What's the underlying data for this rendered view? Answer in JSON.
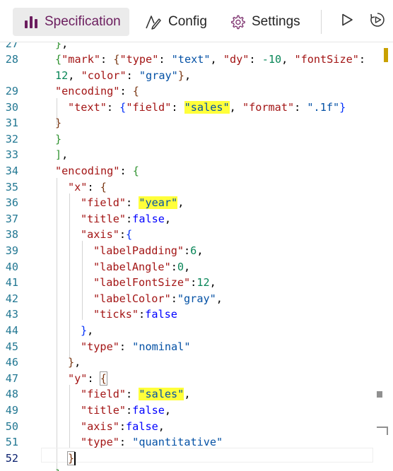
{
  "toolbar": {
    "tabs": [
      {
        "label": "Specification",
        "icon": "bar-chart-icon",
        "active": true
      },
      {
        "label": "Config",
        "icon": "pen-icon",
        "active": false
      },
      {
        "label": "Settings",
        "icon": "gear-icon",
        "active": false
      }
    ],
    "actions": [
      {
        "name": "run-button",
        "icon": "play-icon"
      },
      {
        "name": "auto-run-button",
        "icon": "auto-run-icon"
      }
    ],
    "accent_color": "#6b1d5e"
  },
  "editor": {
    "lines": [
      {
        "n": "27",
        "text": "},"
      },
      {
        "n": "28",
        "text": "{\"mark\": {\"type\": \"text\", \"dy\": -10, \"fontSize\":"
      },
      {
        "n": "",
        "text": "12, \"color\": \"gray\"},"
      },
      {
        "n": "29",
        "text": "\"encoding\": {"
      },
      {
        "n": "30",
        "text": "\"text\": {\"field\": \"sales\", \"format\": \".1f\"}"
      },
      {
        "n": "31",
        "text": "}"
      },
      {
        "n": "32",
        "text": "}"
      },
      {
        "n": "33",
        "text": "],"
      },
      {
        "n": "34",
        "text": "\"encoding\": {"
      },
      {
        "n": "35",
        "text": "\"x\": {"
      },
      {
        "n": "36",
        "text": "\"field\": \"year\","
      },
      {
        "n": "37",
        "text": "\"title\":false,"
      },
      {
        "n": "38",
        "text": "\"axis\":{"
      },
      {
        "n": "39",
        "text": "\"labelPadding\":6,"
      },
      {
        "n": "40",
        "text": "\"labelAngle\":0,"
      },
      {
        "n": "41",
        "text": "\"labelFontSize\":12,"
      },
      {
        "n": "42",
        "text": "\"labelColor\":\"gray\","
      },
      {
        "n": "43",
        "text": "\"ticks\":false"
      },
      {
        "n": "44",
        "text": "},"
      },
      {
        "n": "45",
        "text": "\"type\": \"nominal\""
      },
      {
        "n": "46",
        "text": "},"
      },
      {
        "n": "47",
        "text": "\"y\": {"
      },
      {
        "n": "48",
        "text": "\"field\": \"sales\","
      },
      {
        "n": "49",
        "text": "\"title\":false,"
      },
      {
        "n": "50",
        "text": "\"axis\":false,"
      },
      {
        "n": "51",
        "text": "\"type\": \"quantitative\""
      },
      {
        "n": "52",
        "text": "}"
      },
      {
        "n": "",
        "text": "}"
      }
    ],
    "highlighted_word": "sales",
    "current_line": "52"
  }
}
